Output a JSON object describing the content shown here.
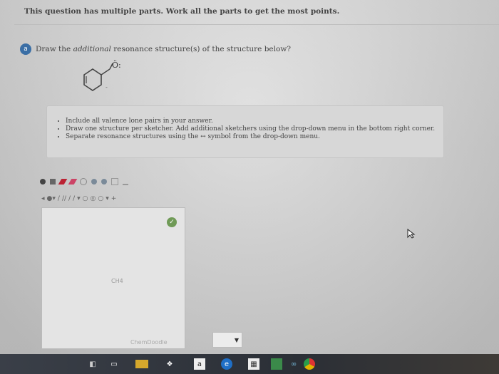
{
  "header": {
    "title": "This question has multiple parts. Work all the parts to get the most points."
  },
  "question": {
    "badge": "a",
    "prefix": "Draw the ",
    "emph": "additional",
    "suffix": " resonance structure(s) of the structure below?"
  },
  "structure": {
    "atom_label": "Ö:",
    "note": "-"
  },
  "hints": [
    "Include all valence lone pairs in your answer.",
    "Draw one structure per sketcher. Add additional sketchers using the drop-down menu in the bottom right corner.",
    "Separate resonance structures using the ↔ symbol from the drop-down menu."
  ],
  "sketcher": {
    "canvas_label": "CH4",
    "brand": "ChemDoodle",
    "dropdown_arrow": "▼"
  },
  "taskbar": {
    "icons": [
      "windows-icon",
      "task-view-icon",
      "file-explorer-icon",
      "dropbox-icon",
      "amazon-icon",
      "edge-icon",
      "store-icon",
      "photos-icon",
      "infinity-icon",
      "chrome-icon"
    ]
  },
  "colors": {
    "badge": "#3a6ea5",
    "ok_button": "#6f9a56",
    "taskbar": "#2b2f36"
  }
}
